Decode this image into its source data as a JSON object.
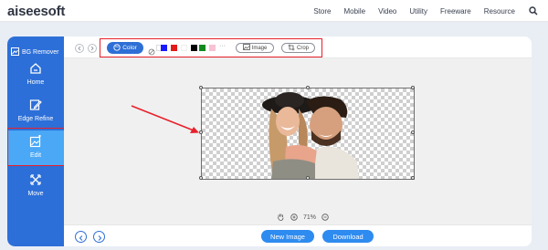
{
  "site": {
    "logo_text": "aiseesoft",
    "nav": [
      "Store",
      "Mobile",
      "Video",
      "Utility",
      "Freeware",
      "Resource"
    ]
  },
  "sidebar": {
    "title": "BG Remover",
    "items": [
      {
        "label": "Home",
        "icon": "home-icon"
      },
      {
        "label": "Edge Refine",
        "icon": "edit-pencil-icon"
      },
      {
        "label": "Edit",
        "icon": "image-edit-icon",
        "active": true
      },
      {
        "label": "Move",
        "icon": "move-arrows-icon"
      }
    ]
  },
  "toolbar": {
    "color_label": "Color",
    "image_label": "Image",
    "crop_label": "Crop",
    "more_label": "···",
    "swatches": [
      "#ffffff",
      "#1a1aff",
      "#e41a1a",
      "#ffffff",
      "#000000",
      "#ffffff",
      "#0f8a1e",
      "#f7c2d2"
    ]
  },
  "zoom": {
    "level": "71%"
  },
  "footer": {
    "new_image_label": "New Image",
    "download_label": "Download"
  },
  "colors": {
    "accent": "#2d6fd8",
    "highlight": "#e8202a",
    "active_item": "#4aa8f6",
    "action": "#2e8bf0"
  }
}
